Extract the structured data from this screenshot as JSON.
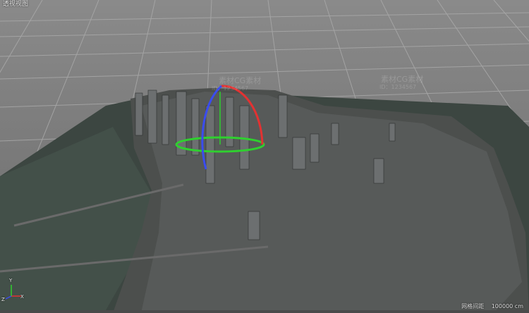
{
  "viewport": {
    "view_name": "透视视图",
    "grid_spacing_label": "网格间距",
    "grid_spacing_value": "100000 cm"
  },
  "axis": {
    "x_label": "X",
    "y_label": "Y",
    "z_label": "Z"
  },
  "watermark": {
    "line1": "素材CG素材",
    "line2": "ID：1234567"
  },
  "colors": {
    "grid_bg": "#7f7f7f",
    "grid_line": "#a8a8a8",
    "water": "#3f4a45",
    "land": "#4b4e4b",
    "gizmo_x": "#e23232",
    "gizmo_y": "#2fd02f",
    "gizmo_z": "#3a4cf0"
  },
  "icons": {
    "rotate_gizmo": "rotate-gizmo-icon",
    "axis_indicator": "axis-indicator-icon"
  }
}
